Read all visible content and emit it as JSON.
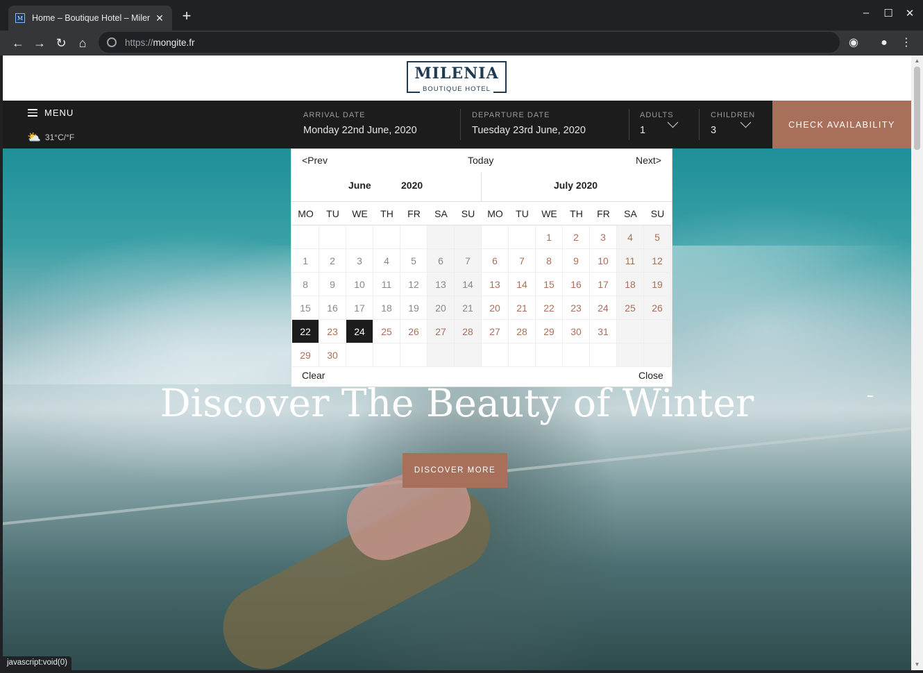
{
  "browser": {
    "tab_title": "Home – Boutique Hotel – Milenia",
    "tab_favicon_letter": "M",
    "new_tab": "+",
    "url_scheme": "https://",
    "url_host": "mongite.fr",
    "status_bar": "javascript:void(0)"
  },
  "site": {
    "logo_name": "MILENIA",
    "logo_sub": "BOUTIQUE HOTEL",
    "menu_label": "MENU",
    "weather_text": "31°C/°F",
    "arrival_label": "ARRIVAL DATE",
    "arrival_value": "Monday 22nd June, 2020",
    "departure_label": "DEPARTURE DATE",
    "departure_value": "Tuesday 23rd June, 2020",
    "adults_label": "ADULTS",
    "adults_value": "1",
    "children_label": "CHILDREN",
    "children_value": "3",
    "check_button": "CHECK AVAILABILITY",
    "headline": "Discover The Beauty of Winter",
    "discover_button": "DISCOVER MORE"
  },
  "datepicker": {
    "prev": "<Prev",
    "today": "Today",
    "next": "Next>",
    "clear": "Clear",
    "close": "Close",
    "weekdays": [
      "MO",
      "TU",
      "WE",
      "TH",
      "FR",
      "SA",
      "SU"
    ],
    "month1": {
      "month": "June",
      "year": "2020",
      "days": [
        "",
        "",
        "",
        "",
        "",
        "",
        "",
        "1",
        "2",
        "3",
        "4",
        "5",
        "6",
        "7",
        "8",
        "9",
        "10",
        "11",
        "12",
        "13",
        "14",
        "15",
        "16",
        "17",
        "18",
        "19",
        "20",
        "21",
        "22",
        "23",
        "24",
        "25",
        "26",
        "27",
        "28",
        "29",
        "30",
        "",
        "",
        "",
        "",
        ""
      ],
      "states": [
        "e",
        "e",
        "e",
        "e",
        "e",
        "e",
        "e",
        "p",
        "p",
        "p",
        "p",
        "p",
        "p",
        "p",
        "p",
        "p",
        "p",
        "p",
        "p",
        "p",
        "p",
        "p",
        "p",
        "p",
        "p",
        "p",
        "p",
        "p",
        "s",
        "a",
        "s",
        "a",
        "a",
        "a",
        "a",
        "a",
        "a",
        "e",
        "e",
        "e",
        "e",
        "e"
      ]
    },
    "month2": {
      "title": "July 2020",
      "days": [
        "",
        "",
        "1",
        "2",
        "3",
        "4",
        "5",
        "6",
        "7",
        "8",
        "9",
        "10",
        "11",
        "12",
        "13",
        "14",
        "15",
        "16",
        "17",
        "18",
        "19",
        "20",
        "21",
        "22",
        "23",
        "24",
        "25",
        "26",
        "27",
        "28",
        "29",
        "30",
        "31",
        "",
        "",
        "",
        "",
        "",
        "",
        "",
        "",
        ""
      ],
      "states": [
        "e",
        "e",
        "a",
        "a",
        "a",
        "a",
        "a",
        "a",
        "a",
        "a",
        "a",
        "a",
        "a",
        "a",
        "a",
        "a",
        "a",
        "a",
        "a",
        "a",
        "a",
        "a",
        "a",
        "a",
        "a",
        "a",
        "a",
        "a",
        "a",
        "a",
        "a",
        "a",
        "a",
        "e",
        "e",
        "e",
        "e",
        "e",
        "e",
        "e",
        "e",
        "e"
      ]
    }
  }
}
